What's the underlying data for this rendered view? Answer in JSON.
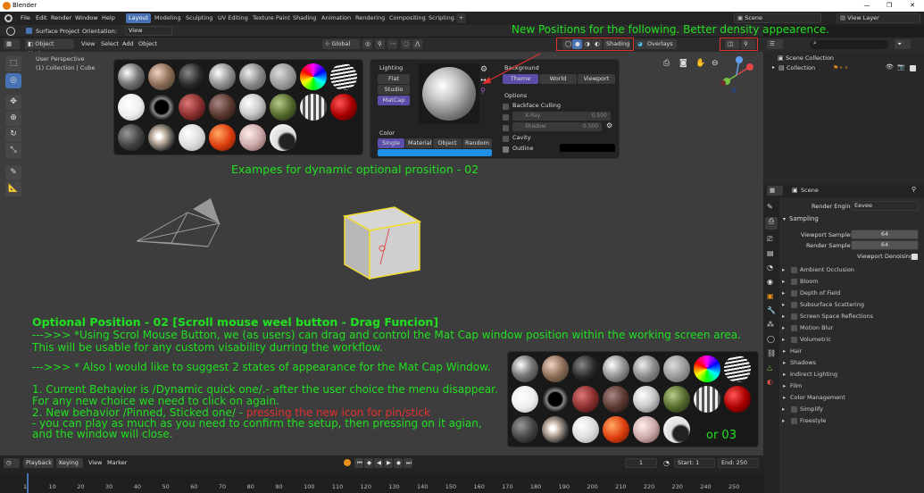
{
  "window": {
    "title": "Blender",
    "controls": [
      "—",
      "❐",
      "✕"
    ]
  },
  "menu": [
    "File",
    "Edit",
    "Render",
    "Window",
    "Help"
  ],
  "workspaces": [
    "Layout",
    "Modeling",
    "Sculpting",
    "UV Editing",
    "Texture Paint",
    "Shading",
    "Animation",
    "Rendering",
    "Compositing",
    "Scripting"
  ],
  "workspace_add": "+",
  "scene_field": "Scene",
  "view_layer_field": "View Layer",
  "tool_settings": {
    "surface_project": "Surface Project",
    "orientation_label": "Orientation:",
    "orientation_value": "View"
  },
  "header": {
    "mode": "Object Mode",
    "view": "View",
    "select": "Select",
    "add": "Add",
    "object": "Object",
    "transform": "Global",
    "shading": "Shading",
    "overlays": "Overlays"
  },
  "viewport": {
    "perspective": "User Perspective",
    "collection": "(1) Collection | Cube"
  },
  "lighting": {
    "label": "Lighting",
    "options": [
      "Flat",
      "Studio",
      "MatCap"
    ],
    "active": "MatCap"
  },
  "color": {
    "label": "Color",
    "options": [
      "Single",
      "Material",
      "Object",
      "Random"
    ],
    "active": "Single",
    "swatch": "#1e90e8"
  },
  "background": {
    "label": "Background",
    "options": [
      "Theme",
      "World",
      "Viewport"
    ],
    "active": "Theme"
  },
  "options": {
    "label": "Options",
    "backface": "Backface Culling",
    "xray": "X-Ray",
    "xray_val": "0.500",
    "shadow": "Shadow",
    "shadow_val": "0.500",
    "cavity": "Cavity",
    "outline": "Outline"
  },
  "annotations": {
    "top": "New Positions  for the following. Better density appearence.",
    "example": "Exampes for dynamic optional prosition - 02",
    "heading": "Optional Position - 02 [Scroll mouse weel button - Drag Funcion]",
    "line1": "--->>> *Using Scrol Mouse Button, we (as users) can drag and control the Mat Cap window position within the working screen area.",
    "line2": "This will be usable for any custom visability durring the workflow.",
    "line3": "--->>> * Also I would like to suggest 2 states of appearance for the Mat Cap Window.",
    "line4": "1. Current Behavior is /Dynamic quick one/.- after the user choice the menu disappear.",
    "line5": "For any new choice we need to click on again.",
    "line6a": "2. New behavior /Pinned, Sticked one/ - ",
    "line6b": "pressing the new icon for pin/stick",
    "line7": "- you can play as much as you need to confirm the setup, then pressing on it agian,",
    "line8": "and the window will close.",
    "or03": "or 03"
  },
  "colors": {
    "accent": "#4772b3",
    "annotation": "#21e021",
    "highlight": "#e03030"
  },
  "outliner": {
    "scene_collection": "Scene Collection",
    "collection": "Collection"
  },
  "properties": {
    "scene": "Scene",
    "render_engine_label": "Render Engine",
    "render_engine_value": "Eevee",
    "sampling": "Sampling",
    "viewport_samples_label": "Viewport Samples",
    "viewport_samples": "64",
    "render_samples_label": "Render Samples",
    "render_samples": "64",
    "viewport_denoising": "Viewport Denoising",
    "panels": [
      "Ambient Occlusion",
      "Bloom",
      "Depth of Field",
      "Subsurface Scattering",
      "Screen Space Reflections",
      "Motion Blur",
      "Volumetric",
      "Hair",
      "Shadows",
      "Indirect Lighting",
      "Film",
      "Color Management",
      "Simplify",
      "Freestyle"
    ]
  },
  "timeline": {
    "playback": "Playback",
    "keying": "Keying",
    "view": "View",
    "marker": "Marker",
    "current": "1",
    "start_label": "Start:",
    "start": "1",
    "end_label": "End:",
    "end": "250",
    "ticks": [
      "1",
      "10",
      "20",
      "30",
      "40",
      "50",
      "60",
      "70",
      "80",
      "90",
      "100",
      "110",
      "120",
      "130",
      "140",
      "150",
      "160",
      "170",
      "180",
      "190",
      "200",
      "210",
      "220",
      "230",
      "240",
      "250"
    ]
  }
}
